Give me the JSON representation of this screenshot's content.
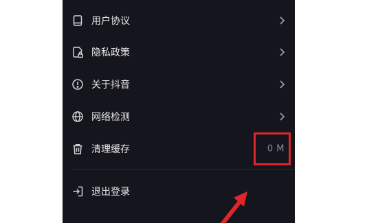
{
  "settings_menu": {
    "items": [
      {
        "label": "用户协议",
        "icon": "book-icon"
      },
      {
        "label": "隐私政策",
        "icon": "lock-document-icon"
      },
      {
        "label": "关于抖音",
        "icon": "info-icon"
      },
      {
        "label": "网络检测",
        "icon": "globe-icon"
      },
      {
        "label": "清理缓存",
        "icon": "trash-icon",
        "value": "0 M"
      }
    ],
    "logout": {
      "label": "退出登录",
      "icon": "logout-icon"
    }
  },
  "colors": {
    "panel_background": "#15151d",
    "text": "#e6e6ea",
    "muted": "#8b8b92",
    "annotation_red": "#e1262b"
  }
}
